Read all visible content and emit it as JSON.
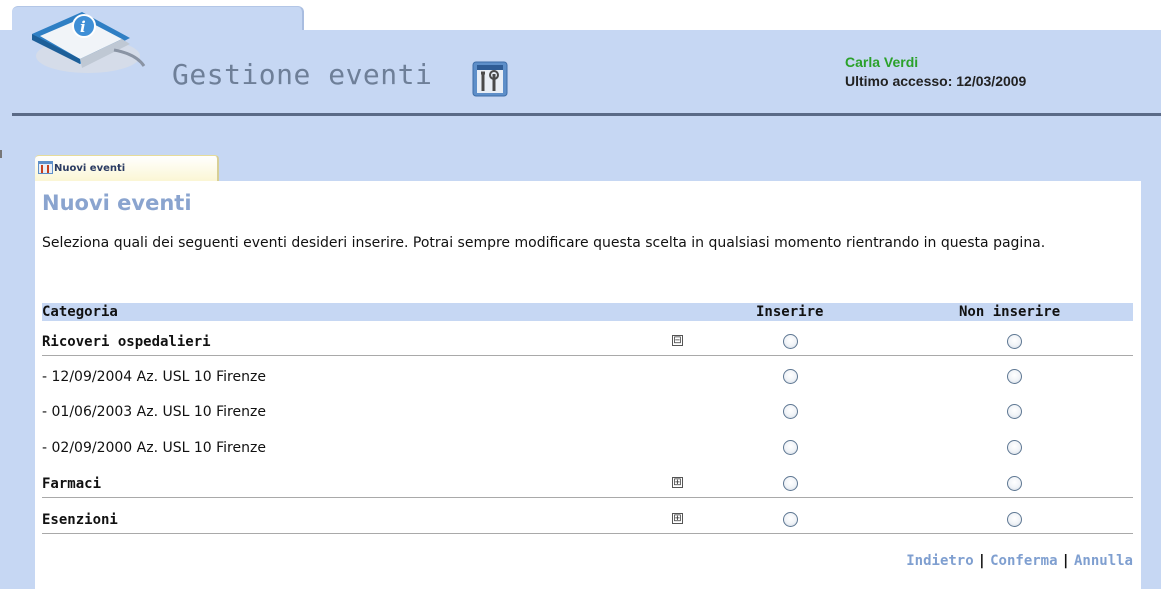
{
  "header": {
    "app_title": "Gestione eventi",
    "user_name": "Carla Verdi",
    "last_access_label": "Ultimo accesso:",
    "last_access_date": "12/03/2009"
  },
  "tab": {
    "label": "Nuovi eventi"
  },
  "page": {
    "title": "Nuovi eventi",
    "intro": "Seleziona quali dei seguenti eventi desideri inserire. Potrai sempre modificare questa scelta in qualsiasi momento rientrando in questa pagina."
  },
  "table": {
    "headers": {
      "category": "Categoria",
      "insert": "Inserire",
      "not_insert": "Non inserire"
    },
    "rows": [
      {
        "label": "Ricoveri ospedalieri",
        "toggle": "⊟"
      },
      {
        "label": "- 12/09/2004 Az. USL 10 Firenze"
      },
      {
        "label": "- 01/06/2003 Az. USL 10 Firenze"
      },
      {
        "label": "- 02/09/2000 Az. USL 10 Firenze"
      },
      {
        "label": "Farmaci",
        "toggle": "⊞"
      },
      {
        "label": "Esenzioni",
        "toggle": "⊞"
      }
    ]
  },
  "footer": {
    "back": "Indietro",
    "confirm": "Conferma",
    "cancel": "Annulla",
    "separator": "|"
  },
  "colors": {
    "header_bg": "#c6d7f3",
    "title_blue": "#8aa4cf",
    "link_blue": "#7f9fd0",
    "user_green": "#2aa12a"
  },
  "icons": [
    "book-logo-icon",
    "tools-icon",
    "tab-tools-icon",
    "collapse-icon",
    "expand-icon"
  ]
}
